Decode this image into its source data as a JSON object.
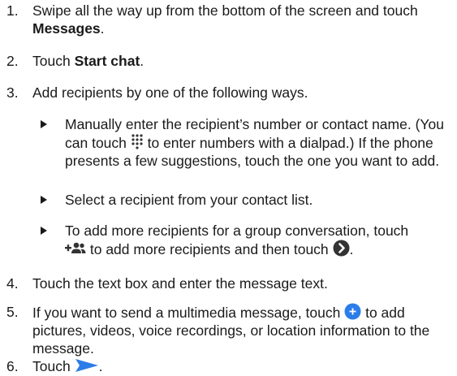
{
  "steps": [
    {
      "num": "1.",
      "pre": "Swipe all the way up from the bottom of the screen and touch ",
      "bold": "Messages",
      "post": "."
    },
    {
      "num": "2.",
      "pre": "Touch ",
      "bold": "Start chat",
      "post": "."
    },
    {
      "num": "3.",
      "text": "Add recipients by one of the following ways."
    },
    {
      "num": "4.",
      "text": "Touch the text box and enter the message text."
    },
    {
      "num": "5.",
      "pre": "If you want to send a multimedia message, touch ",
      "post": " to add pictures, videos, voice recordings, or location information to the message."
    },
    {
      "num": "6.",
      "pre": "Touch ",
      "post": "."
    }
  ],
  "substeps": [
    {
      "a": "Manually enter the recipient’s number or contact name. (You can touch ",
      "b": " to enter numbers with a dialpad.) If the phone presents a few suggestions, touch the one you want to add."
    },
    {
      "a": "Select a recipient from your contact list."
    },
    {
      "a": "To add more recipients for a group conversation, touch ",
      "b": " to add more recipients and then touch ",
      "c": "."
    }
  ],
  "colors": {
    "text": "#1a1a1a",
    "accent_blue": "#2b7de9",
    "dark_icon": "#333333"
  },
  "icons": [
    "dialpad-icon",
    "add-people-icon",
    "next-arrow-icon",
    "add-attachment-icon",
    "send-icon"
  ]
}
